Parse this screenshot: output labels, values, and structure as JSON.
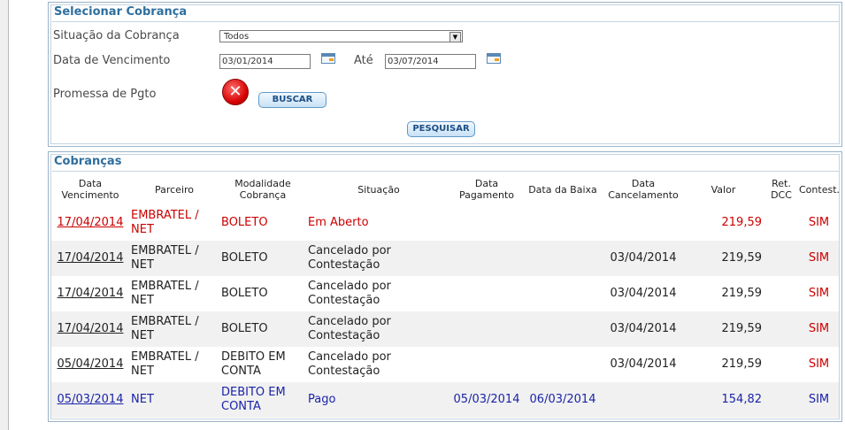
{
  "filter": {
    "title": "Selecionar Cobrança",
    "situacao_label": "Situação da Cobrança",
    "situacao_value": "Todos",
    "vencimento_label": "Data de Vencimento",
    "date_from": "03/01/2014",
    "ate_label": "Até",
    "date_to": "03/07/2014",
    "promessa_label": "Promessa de Pgto",
    "buscar_label": "BUSCAR",
    "pesquisar_label": "PESQUISAR"
  },
  "cobrancas": {
    "title": "Cobranças",
    "headers": {
      "data_vencimento": [
        "Data",
        "Vencimento"
      ],
      "parceiro": "Parceiro",
      "modalidade": [
        "Modalidade",
        "Cobrança"
      ],
      "situacao": "Situação",
      "data_pagamento": [
        "Data",
        "Pagamento"
      ],
      "data_baixa": "Data da Baixa",
      "data_cancelamento": [
        "Data",
        "Cancelamento"
      ],
      "valor": "Valor",
      "ret_dcc": [
        "Ret.",
        "DCC"
      ],
      "contest": "Contest."
    },
    "rows": [
      {
        "venc": "17/04/2014",
        "parceiro": [
          "EMBRATEL /",
          "NET"
        ],
        "modalidade": [
          "BOLETO",
          ""
        ],
        "situacao": [
          "Em Aberto",
          ""
        ],
        "pagamento": "",
        "baixa": "",
        "cancelamento": "",
        "valor": "219,59",
        "dcc": "",
        "contest": "SIM",
        "style": "red"
      },
      {
        "venc": "17/04/2014",
        "parceiro": [
          "EMBRATEL /",
          "NET"
        ],
        "modalidade": [
          "BOLETO",
          ""
        ],
        "situacao": [
          "Cancelado por",
          "Contestação"
        ],
        "pagamento": "",
        "baixa": "",
        "cancelamento": "03/04/2014",
        "valor": "219,59",
        "dcc": "",
        "contest": "SIM",
        "style": "black"
      },
      {
        "venc": "17/04/2014",
        "parceiro": [
          "EMBRATEL /",
          "NET"
        ],
        "modalidade": [
          "BOLETO",
          ""
        ],
        "situacao": [
          "Cancelado por",
          "Contestação"
        ],
        "pagamento": "",
        "baixa": "",
        "cancelamento": "03/04/2014",
        "valor": "219,59",
        "dcc": "",
        "contest": "SIM",
        "style": "black"
      },
      {
        "venc": "17/04/2014",
        "parceiro": [
          "EMBRATEL /",
          "NET"
        ],
        "modalidade": [
          "BOLETO",
          ""
        ],
        "situacao": [
          "Cancelado por",
          "Contestação"
        ],
        "pagamento": "",
        "baixa": "",
        "cancelamento": "03/04/2014",
        "valor": "219,59",
        "dcc": "",
        "contest": "SIM",
        "style": "black"
      },
      {
        "venc": "05/04/2014",
        "parceiro": [
          "EMBRATEL /",
          "NET"
        ],
        "modalidade": [
          "DEBITO EM",
          "CONTA"
        ],
        "situacao": [
          "Cancelado por",
          "Contestação"
        ],
        "pagamento": "",
        "baixa": "",
        "cancelamento": "03/04/2014",
        "valor": "219,59",
        "dcc": "",
        "contest": "SIM",
        "style": "black"
      },
      {
        "venc": "05/03/2014",
        "parceiro": [
          "NET",
          ""
        ],
        "modalidade": [
          "DEBITO EM",
          "CONTA"
        ],
        "situacao": [
          "Pago",
          ""
        ],
        "pagamento": "05/03/2014",
        "baixa": "06/03/2014",
        "cancelamento": "",
        "valor": "154,82",
        "dcc": "",
        "contest": "SIM",
        "style": "blue"
      }
    ]
  },
  "colors": {
    "title_blue": "#2e6f9e",
    "open_red": "#cc0000",
    "paid_blue": "#1a23a8"
  },
  "icons": {
    "calendar": "calendar-icon",
    "clear": "error-x-icon"
  }
}
